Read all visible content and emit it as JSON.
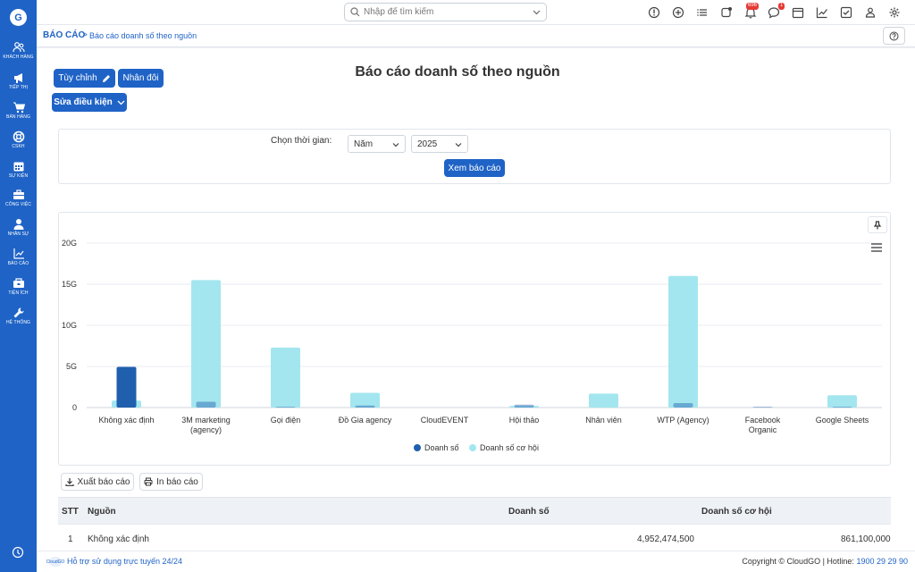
{
  "sidebar": {
    "logo": "G",
    "items": [
      {
        "label": "KHÁCH HÀNG",
        "icon": "users-icon"
      },
      {
        "label": "TIẾP THỊ",
        "icon": "megaphone-icon"
      },
      {
        "label": "BÁN HÀNG",
        "icon": "cart-icon"
      },
      {
        "label": "CSKH",
        "icon": "lifebuoy-icon"
      },
      {
        "label": "SỰ KIỆN",
        "icon": "calendar-icon"
      },
      {
        "label": "CÔNG VIỆC",
        "icon": "briefcase-icon"
      },
      {
        "label": "NHÂN SỰ",
        "icon": "person-icon"
      },
      {
        "label": "BÁO CÁO",
        "icon": "report-icon"
      },
      {
        "label": "TIỆN ÍCH",
        "icon": "tools-box-icon"
      },
      {
        "label": "HỆ THỐNG",
        "icon": "wrench-icon"
      }
    ]
  },
  "topbar": {
    "search_placeholder": "Nhập để tìm kiếm",
    "notification_count": "696",
    "message_count": "1"
  },
  "breadcrumb": {
    "root": "BÁO CÁO",
    "separator": ">",
    "current": "Báo cáo doanh số theo nguồn"
  },
  "toolbar": {
    "customize_label": "Tùy chỉnh",
    "duplicate_label": "Nhân đôi",
    "edit_conditions_label": "Sửa điều kiện"
  },
  "page_title": "Báo cáo doanh số theo nguồn",
  "filter": {
    "time_label": "Chọn thời gian:",
    "period_value": "Năm",
    "year_value": "2025",
    "view_button": "Xem báo cáo"
  },
  "chart_data": {
    "type": "bar",
    "categories": [
      "Không xác định",
      "3M marketing (agency)",
      "Gọi điện",
      "Đồ Gia agency",
      "CloudEVENT",
      "Hội thảo",
      "Nhân viên",
      "WTP (Agency)",
      "Facebook Organic",
      "Google Sheets"
    ],
    "series": [
      {
        "name": "Doanh số",
        "color": "#1f5fae",
        "values": [
          4.95,
          0.7,
          0.1,
          0.25,
          0,
          0.35,
          0,
          0.55,
          0.1,
          0.1
        ]
      },
      {
        "name": "Doanh số cơ hội",
        "color": "#a3e6ef",
        "values": [
          0.86,
          15.5,
          7.3,
          1.8,
          0,
          0.2,
          1.7,
          16.0,
          0,
          1.5
        ]
      }
    ],
    "y_ticks": [
      "0",
      "5G",
      "10G",
      "15G",
      "20G"
    ],
    "ylim": [
      0,
      20
    ],
    "grid": true,
    "legend": "bottom-center"
  },
  "actions": {
    "export_label": "Xuất báo cáo",
    "print_label": "In báo cáo"
  },
  "table": {
    "headers": [
      "STT",
      "Nguồn",
      "Doanh số",
      "Doanh số cơ hội"
    ],
    "rows": [
      [
        "1",
        "Không xác định",
        "4,952,474,500",
        "861,100,000"
      ]
    ]
  },
  "footer": {
    "logo_text": "CloudGO",
    "support": "Hỗ trợ sử dụng trực tuyến 24/24",
    "copyright": "Copyright © CloudGO | Hotline: ",
    "hotline": "1900 29 29 90"
  }
}
